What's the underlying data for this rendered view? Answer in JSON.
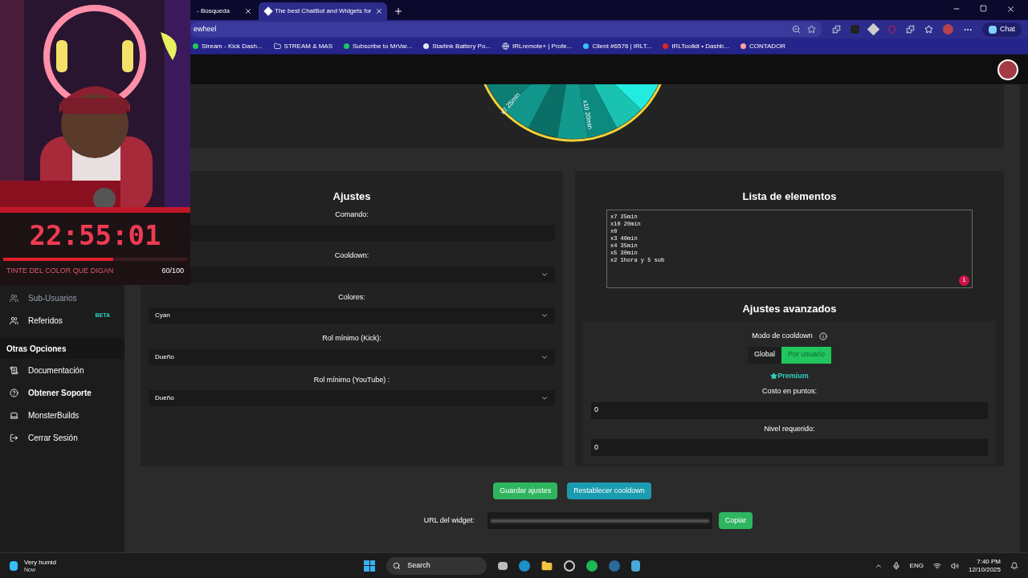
{
  "browser": {
    "tabs": [
      {
        "title": "- Búsqueda",
        "selected": false
      },
      {
        "title": "The best ChatBot and Widgets for",
        "selected": true
      }
    ],
    "address": "ewheel",
    "bookmarks": [
      "Stream - Kick Dash...",
      "STREAM & MAS",
      "Subscribe to MrVar...",
      "Starlink Battery Po...",
      "IRLremote+ | Profe...",
      "Client #6576 | IRLT...",
      "IRLToolkit • Dashb...",
      "CONTADOR"
    ],
    "chat_label": "Chat"
  },
  "overlay": {
    "timer": "22:55:01",
    "goal": "TINTE DEL COLOR QUE DIGAN",
    "count": "60/100",
    "level": 0.6
  },
  "sidebar": {
    "items": [
      {
        "kind": "item",
        "label": "Sub-Usuarios"
      },
      {
        "kind": "item",
        "label": "Referidos",
        "badge": "BETA"
      },
      {
        "kind": "heading",
        "label": "Otras Opciones"
      },
      {
        "kind": "item",
        "label": "Documentación"
      },
      {
        "kind": "item",
        "label": "Obtener Soporte"
      },
      {
        "kind": "item",
        "label": "MonsterBuilds"
      },
      {
        "kind": "item",
        "label": "Cerrar Sesión"
      }
    ]
  },
  "wheel": {
    "labels": [
      "x7 25min",
      "x10 20min"
    ]
  },
  "settings": {
    "title": "Ajustes",
    "fields": [
      {
        "label": "Comando:",
        "kind": "text"
      },
      {
        "label": "Cooldown:",
        "kind": "select"
      },
      {
        "label": "Colores:",
        "kind": "select",
        "value": "Cyan"
      },
      {
        "label": "Rol mínimo (Kick):",
        "kind": "select",
        "value": "Dueño"
      },
      {
        "label": "Rol mínimo (YouTube) :",
        "kind": "select",
        "value": "Dueño"
      }
    ]
  },
  "elements": {
    "title": "Lista de elementos",
    "lines": [
      "x7 25min",
      "x10 20min",
      "x0",
      "x3 40min",
      "x4 35min",
      "x5 30min",
      "x2 1hora y 5 sub"
    ],
    "badge": "1"
  },
  "advanced": {
    "title": "Ajustes avanzados",
    "mode_label": "Modo de cooldown",
    "modes": [
      {
        "label": "Global",
        "selected": false
      },
      {
        "label": "Por usuario",
        "selected": true
      }
    ],
    "premium": "Premium",
    "fields": [
      {
        "label": "Costo en puntos:",
        "value": "0"
      },
      {
        "label": "Nivel requerido:",
        "value": "0"
      }
    ]
  },
  "actions": {
    "buttons": [
      {
        "label": "Guardar ajustes",
        "kind": "save"
      },
      {
        "label": "Restablecer cooldown",
        "kind": "reset"
      }
    ],
    "url_label": "URL del widget:",
    "copy": "Copiar"
  },
  "taskbar": {
    "weather": "Very humid",
    "weather_sub": "Now",
    "search": "Search",
    "lang": "ENG",
    "time": "7:40 PM",
    "date": "12/10/2025"
  }
}
